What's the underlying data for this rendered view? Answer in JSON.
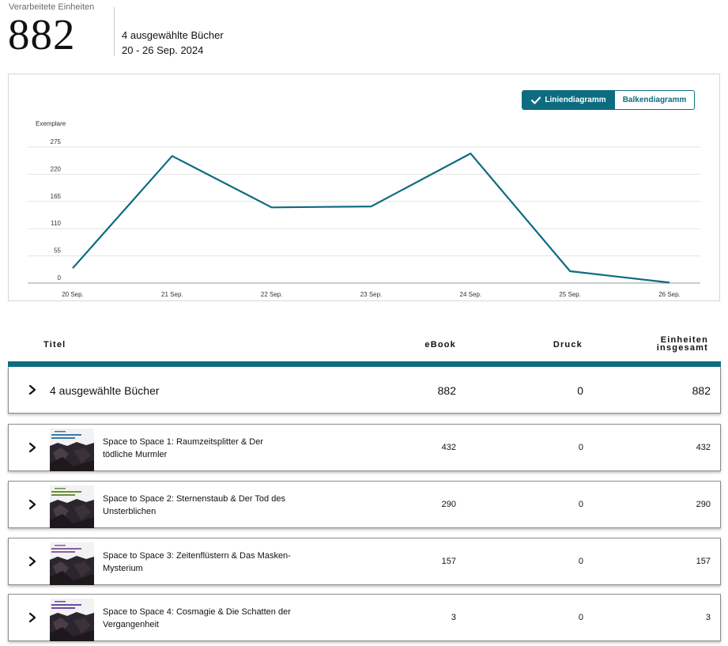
{
  "summary": {
    "label": "Verarbeitete Einheiten",
    "value": "882",
    "books_selected": "4 ausgewählte Bücher",
    "date_range": "20 - 26 Sep. 2024"
  },
  "chart_toggle": {
    "line_label": "Liniendiagramm",
    "bar_label": "Balkendiagramm",
    "selected": "line"
  },
  "chart_data": {
    "type": "line",
    "ylabel": "Exemplare",
    "x": [
      "20 Sep.",
      "21 Sep.",
      "22 Sep.",
      "23 Sep.",
      "24 Sep.",
      "25 Sep.",
      "26 Sep."
    ],
    "yticks": [
      0,
      55,
      110,
      165,
      220,
      275
    ],
    "ylim": [
      0,
      275
    ],
    "series": [
      {
        "values": [
          30,
          257,
          153,
          155,
          262,
          24,
          1
        ],
        "color": "#0e6c80"
      }
    ],
    "grid": true
  },
  "table": {
    "headers": {
      "title": "Titel",
      "ebook": "eBook",
      "print": "Druck",
      "total_line1": "Einheiten",
      "total_line2": "insgesamt"
    },
    "total_row": {
      "label": "4 ausgewählte Bücher",
      "ebook": "882",
      "print": "0",
      "total": "882"
    },
    "rows": [
      {
        "title_line1": "Space to Space 1: Raumzeitsplitter & Der",
        "title_line2": "tödliche Murmler",
        "ebook": "432",
        "print": "0",
        "total": "432",
        "cover_accent": "#3a7aa8"
      },
      {
        "title_line1": "Space to Space 2: Sternenstaub & Der Tod des",
        "title_line2": "Unsterblichen",
        "ebook": "290",
        "print": "0",
        "total": "290",
        "cover_accent": "#6b8f3a"
      },
      {
        "title_line1": "Space to Space 3: Zeitenflüstern & Das Masken-",
        "title_line2": "Mysterium",
        "ebook": "157",
        "print": "0",
        "total": "157",
        "cover_accent": "#8a5fa0"
      },
      {
        "title_line1": "Space to Space 4: Cosmagie & Die Schatten der",
        "title_line2": "Vergangenheit",
        "ebook": "3",
        "print": "0",
        "total": "3",
        "cover_accent": "#6a4aa8"
      }
    ]
  }
}
